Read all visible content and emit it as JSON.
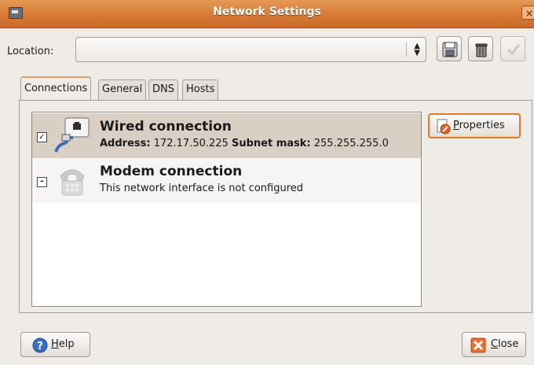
{
  "window": {
    "title": "Network Settings"
  },
  "location": {
    "label": "Location:",
    "value": ""
  },
  "tabs": [
    {
      "label": "Connections",
      "active": true
    },
    {
      "label": "General",
      "active": false
    },
    {
      "label": "DNS",
      "active": false
    },
    {
      "label": "Hosts",
      "active": false
    }
  ],
  "connections": [
    {
      "checked": true,
      "name": "Wired connection",
      "address_label": "Address:",
      "address": "172.17.50.225",
      "mask_label": "Subnet mask:",
      "mask": "255.255.255.0",
      "icon": "wired-network-icon"
    },
    {
      "checked": false,
      "name": "Modem connection",
      "status": "This network interface is not configured",
      "icon": "modem-phone-icon"
    }
  ],
  "buttons": {
    "properties_hotkey": "P",
    "properties_rest": "roperties",
    "help_hotkey": "H",
    "help_rest": "elp",
    "close_hotkey": "C",
    "close_rest": "lose"
  },
  "colors": {
    "titlebar": "#d77b37",
    "selection": "#d9cfc5",
    "focus": "#e07a2b"
  }
}
